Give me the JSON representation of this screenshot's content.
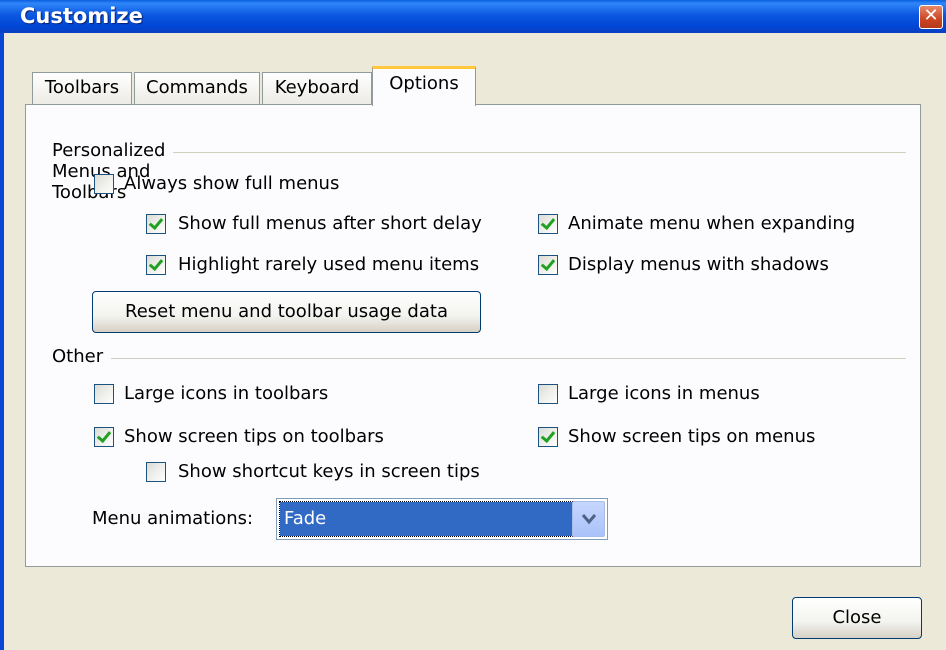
{
  "window": {
    "title": "Customize",
    "close_glyph": "✕"
  },
  "tabs": [
    {
      "label": "Toolbars",
      "active": false
    },
    {
      "label": "Commands",
      "active": false
    },
    {
      "label": "Keyboard",
      "active": false
    },
    {
      "label": "Options",
      "active": true
    }
  ],
  "personalized": {
    "heading": "Personalized Menus and Toolbars",
    "always_full": {
      "label": "Always show full menus",
      "checked": false
    },
    "full_after_delay": {
      "label": "Show full menus after short delay",
      "checked": true
    },
    "animate_expand": {
      "label": "Animate menu when expanding",
      "checked": true
    },
    "highlight_rare": {
      "label": "Highlight rarely used menu items",
      "checked": true
    },
    "menu_shadows": {
      "label": "Display menus with shadows",
      "checked": true
    },
    "reset_button": "Reset menu and toolbar usage data"
  },
  "other": {
    "heading": "Other",
    "large_icons_toolbars": {
      "label": "Large icons in toolbars",
      "checked": false
    },
    "large_icons_menus": {
      "label": "Large icons in menus",
      "checked": false
    },
    "tips_toolbars": {
      "label": "Show screen tips on toolbars",
      "checked": true
    },
    "tips_menus": {
      "label": "Show screen tips on menus",
      "checked": true
    },
    "shortcut_keys": {
      "label": "Show shortcut keys in screen tips",
      "checked": false
    },
    "menu_animations_label": "Menu animations:",
    "menu_animations_value": "Fade"
  },
  "footer": {
    "close_button": "Close"
  },
  "colors": {
    "title_bar": "#0054e3",
    "face": "#ece9d8",
    "selection": "#316ac5",
    "check": "#21a121"
  }
}
